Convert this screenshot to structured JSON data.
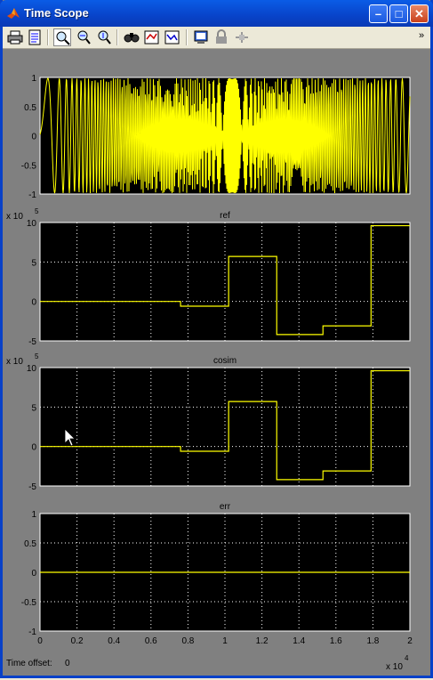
{
  "window": {
    "title": "Time Scope",
    "min_glyph": "–",
    "max_glyph": "□",
    "close_glyph": "✕"
  },
  "toolbar": {
    "tools": [
      "print-icon",
      "parameters-icon",
      "zoom-icon",
      "zoom-x-icon",
      "zoom-y-icon",
      "autoscale-icon",
      "save-axes-icon",
      "restore-axes-icon",
      "float-scope-icon",
      "lock-icon",
      "signal-selection-icon"
    ],
    "active_tool": "zoom-icon",
    "overflow_glyph": "»"
  },
  "status": {
    "time_offset_label": "Time offset:",
    "time_offset_value": "0"
  },
  "colors": {
    "trace": "#ffff00",
    "axes_bg": "#000000",
    "figure_bg": "#808080",
    "grid": "#ffffff"
  },
  "chart_data": [
    {
      "type": "line",
      "title": "",
      "x": [
        0,
        2
      ],
      "xlim": [
        0,
        2
      ],
      "ylim": [
        -1,
        1
      ],
      "yticks": [
        "1",
        "0.5",
        "0",
        "-0.5",
        "-1"
      ],
      "xticks": [
        "0",
        "0.2",
        "0.4",
        "0.6",
        "0.8",
        "1",
        "1.2",
        "1.4",
        "1.6",
        "1.8",
        "2"
      ],
      "x_exponent": "x 10",
      "x_exponent_power": "4",
      "show_xticks": false,
      "grid": false,
      "series": [
        {
          "values": "dense oscillation spanning -1 to 1 (chirp)"
        }
      ]
    },
    {
      "type": "line",
      "title": "ref",
      "x": [
        0,
        0.76,
        0.76,
        1.02,
        1.02,
        1.28,
        1.28,
        1.53,
        1.53,
        1.79,
        1.79,
        2.0
      ],
      "xlim": [
        0,
        2
      ],
      "ylim": [
        -5,
        10
      ],
      "yticks": [
        "10",
        "5",
        "0",
        "-5"
      ],
      "y_exponent": "x 10",
      "y_exponent_power": "5",
      "grid": true,
      "series": [
        {
          "values": [
            0,
            0,
            -0.6,
            -0.6,
            5.7,
            5.7,
            -4.2,
            -4.2,
            -3.1,
            -3.1,
            9.6,
            9.6
          ]
        }
      ]
    },
    {
      "type": "line",
      "title": "cosim",
      "x": [
        0,
        0.76,
        0.76,
        1.02,
        1.02,
        1.28,
        1.28,
        1.53,
        1.53,
        1.79,
        1.79,
        2.0
      ],
      "xlim": [
        0,
        2
      ],
      "ylim": [
        -5,
        10
      ],
      "yticks": [
        "10",
        "5",
        "0",
        "-5"
      ],
      "y_exponent": "x 10",
      "y_exponent_power": "5",
      "grid": true,
      "series": [
        {
          "values": [
            0,
            0,
            -0.6,
            -0.6,
            5.7,
            5.7,
            -4.2,
            -4.2,
            -3.1,
            -3.1,
            9.6,
            9.6
          ]
        }
      ]
    },
    {
      "type": "line",
      "title": "err",
      "x": [
        0,
        2
      ],
      "xlim": [
        0,
        2
      ],
      "ylim": [
        -1,
        1
      ],
      "yticks": [
        "1",
        "0.5",
        "0",
        "-0.5",
        "-1"
      ],
      "xticks": [
        "0",
        "0.2",
        "0.4",
        "0.6",
        "0.8",
        "1",
        "1.2",
        "1.4",
        "1.6",
        "1.8",
        "2"
      ],
      "x_exponent": "x 10",
      "x_exponent_power": "4",
      "show_xticks": true,
      "grid": true,
      "series": [
        {
          "values": [
            0,
            0
          ]
        }
      ]
    }
  ]
}
